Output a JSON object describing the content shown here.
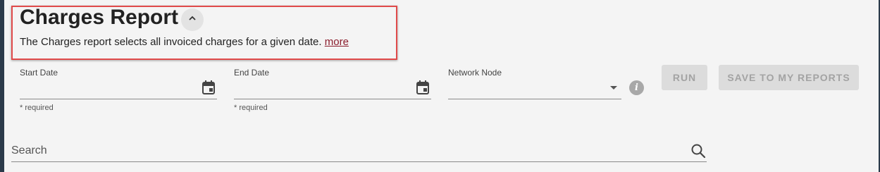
{
  "header": {
    "title": "Charges Report",
    "collapse_icon": "chevron-up-icon",
    "description": "The Charges report selects all invoiced charges for a given date.",
    "more_link": "more",
    "highlight_color": "#e04a4a",
    "link_color": "#8b1e2d"
  },
  "form": {
    "start_date": {
      "label": "Start Date",
      "value": "",
      "hint": "* required",
      "icon": "calendar-icon"
    },
    "end_date": {
      "label": "End Date",
      "value": "",
      "hint": "* required",
      "icon": "calendar-icon"
    },
    "network_node": {
      "label": "Network Node",
      "value": "",
      "icon": "dropdown-arrow-icon"
    },
    "info_icon": "info-icon",
    "run_label": "RUN",
    "save_label": "SAVE TO MY REPORTS",
    "buttons_state": "disabled"
  },
  "search": {
    "placeholder": "Search",
    "value": "",
    "icon": "search-icon"
  }
}
